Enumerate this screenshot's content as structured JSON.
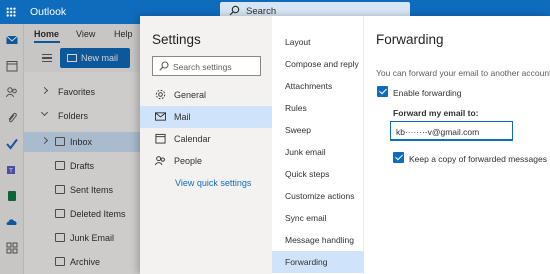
{
  "app": {
    "title": "Outlook"
  },
  "search": {
    "label": "Search"
  },
  "ribbon": {
    "tabs": [
      "Home",
      "View",
      "Help"
    ],
    "new_mail": "New mail"
  },
  "nav": {
    "favorites": "Favorites",
    "folders": "Folders",
    "items": [
      "Inbox",
      "Drafts",
      "Sent Items",
      "Deleted Items",
      "Junk Email",
      "Archive"
    ],
    "selected": "Inbox"
  },
  "settings": {
    "title": "Settings",
    "search_placeholder": "Search settings",
    "categories": [
      "General",
      "Mail",
      "Calendar",
      "People"
    ],
    "selected_category": "Mail",
    "view_quick": "View quick settings",
    "subcategories": [
      "Layout",
      "Compose and reply",
      "Attachments",
      "Rules",
      "Sweep",
      "Junk email",
      "Quick steps",
      "Customize actions",
      "Sync email",
      "Message handling",
      "Forwarding"
    ],
    "selected_subcategory": "Forwarding"
  },
  "forwarding": {
    "title": "Forwarding",
    "description": "You can forward your email to another account",
    "enable_label": "Enable forwarding",
    "enable_checked": true,
    "forward_label": "Forward my email to:",
    "email_value": "kb········v@gmail.com",
    "keep_copy_label": "Keep a copy of forwarded messages",
    "keep_copy_checked": true
  },
  "colors": {
    "accent": "#0f6cbd",
    "selected_bg": "#cfe4fa"
  }
}
